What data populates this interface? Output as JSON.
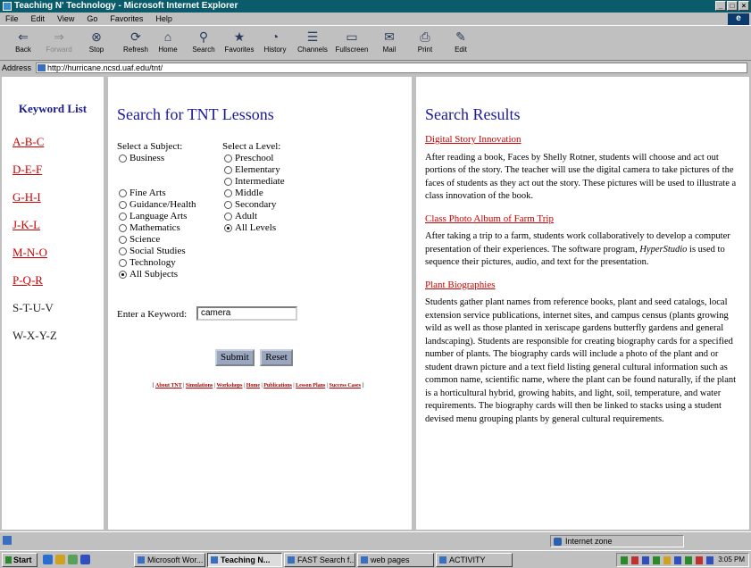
{
  "window": {
    "title": "Teaching N' Technology - Microsoft Internet Explorer"
  },
  "menu": [
    "File",
    "Edit",
    "View",
    "Go",
    "Favorites",
    "Help"
  ],
  "toolbar": [
    {
      "label": "Back",
      "icon": "back-arrow-icon",
      "glyph": "⇐"
    },
    {
      "label": "Forward",
      "icon": "forward-arrow-icon",
      "glyph": "⇒"
    },
    {
      "label": "Stop",
      "icon": "stop-icon",
      "glyph": "⊗"
    },
    {
      "label": "Refresh",
      "icon": "refresh-icon",
      "glyph": "⟳"
    },
    {
      "label": "Home",
      "icon": "home-icon",
      "glyph": "⌂"
    },
    {
      "label": "Search",
      "icon": "search-icon",
      "glyph": "⚲"
    },
    {
      "label": "Favorites",
      "icon": "favorites-icon",
      "glyph": "★"
    },
    {
      "label": "History",
      "icon": "history-icon",
      "glyph": "◔"
    },
    {
      "label": "Channels",
      "icon": "channels-icon",
      "glyph": "☰"
    },
    {
      "label": "Fullscreen",
      "icon": "fullscreen-icon",
      "glyph": "▭"
    },
    {
      "label": "Mail",
      "icon": "mail-icon",
      "glyph": "✉"
    },
    {
      "label": "Print",
      "icon": "print-icon",
      "glyph": "⎙"
    },
    {
      "label": "Edit",
      "icon": "edit-icon",
      "glyph": "✎"
    }
  ],
  "address": {
    "label": "Address",
    "url": "http://hurricane.ncsd.uaf.edu/tnt/"
  },
  "keywords": {
    "title": "Keyword List",
    "links": [
      "A-B-C",
      "D-E-F",
      "G-H-I",
      "J-K-L",
      "M-N-O",
      "P-Q-R"
    ],
    "plain": [
      "S-T-U-V",
      "W-X-Y-Z"
    ]
  },
  "search": {
    "title": "Search for TNT Lessons",
    "subject_label": "Select a Subject:",
    "level_label": "Select a Level:",
    "subjects_top": [
      "Business"
    ],
    "subjects": [
      "Fine Arts",
      "Guidance/Health",
      "Language Arts",
      "Mathematics",
      "Science",
      "Social Studies",
      "Technology",
      "All Subjects"
    ],
    "subject_selected": "All Subjects",
    "levels": [
      "Preschool",
      "Elementary",
      "Intermediate",
      "Middle",
      "Secondary",
      "Adult",
      "All Levels"
    ],
    "level_selected": "All Levels",
    "keyword_label": "Enter a Keyword:",
    "keyword_value": "camera",
    "submit_label": "Submit",
    "reset_label": "Reset",
    "footer_links": [
      "About TNT",
      "Simulations",
      "Workshops",
      "Home",
      "Publications",
      "Lesson Plans",
      "Success Cases"
    ]
  },
  "results": {
    "title": "Search Results",
    "items": [
      {
        "title": "Digital Story Innovation",
        "body": "After reading a book, Faces by Shelly Rotner, students will choose and act out portions of the story. The teacher will use the digital camera to take pictures of the faces of students as they act out the story. These pictures will be used to illustrate a class innovation of the book."
      },
      {
        "title": "Class Photo Album of Farm Trip",
        "body_pre": "After taking a trip to a farm, students work collaboratively to develop a computer presentation of their experiences. The software program, ",
        "body_ital": "HyperStudio",
        "body_post": " is used to sequence their pictures, audio, and text for the presentation."
      },
      {
        "title": "Plant Biographies",
        "body": "Students gather plant names from reference books, plant and seed catalogs, local extension service publications, internet sites, and campus census (plants growing wild as well as those planted in xeriscape gardens butterfly gardens and general landscaping). Students are responsible for creating biography cards for a specified number of plants. The biography cards will include a photo of the plant and or student drawn picture and a text field listing general cultural information such as common name, scientific name, where the plant can be found naturally, if the plant is a horticultural hybrid, growing habits, and light, soil, temperature, and water requirements. The biography cards will then be linked to stacks using a student devised menu grouping plants by general cultural requirements."
      }
    ]
  },
  "status": {
    "zone": "Internet zone"
  },
  "taskbar": {
    "start": "Start",
    "tasks": [
      "Microsoft Wor...",
      "Teaching N...",
      "FAST Search f...",
      "web pages",
      "ACTIVITY"
    ],
    "clock": "3:05 PM"
  }
}
